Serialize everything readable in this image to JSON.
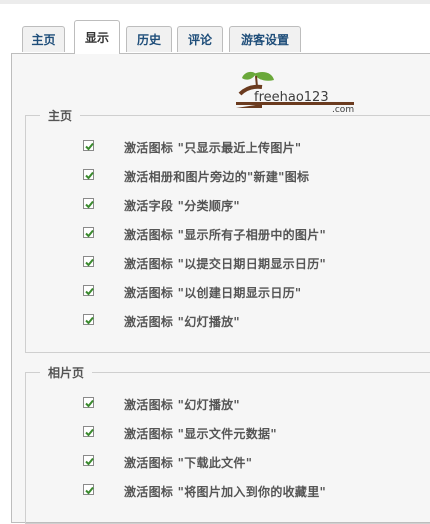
{
  "tabs": [
    {
      "label": "主页",
      "active": false
    },
    {
      "label": "显示",
      "active": true
    },
    {
      "label": "历史",
      "active": false
    },
    {
      "label": "评论",
      "active": false
    },
    {
      "label": "游客设置",
      "active": false
    }
  ],
  "logo": {
    "text": "freehao123",
    "suffix": ".com"
  },
  "sections": [
    {
      "legend": "主页",
      "items": [
        {
          "label": "激活图标 \"只显示最近上传图片\"",
          "checked": true
        },
        {
          "label": "激活相册和图片旁边的\"新建\"图标",
          "checked": true
        },
        {
          "label": "激活字段 \"分类顺序\"",
          "checked": true
        },
        {
          "label": "激活图标 \"显示所有子相册中的图片\"",
          "checked": true
        },
        {
          "label": "激活图标 \"以提交日期日期显示日历\"",
          "checked": true
        },
        {
          "label": "激活图标 \"以创建日期显示日历\"",
          "checked": true
        },
        {
          "label": "激活图标 \"幻灯播放\"",
          "checked": true
        }
      ]
    },
    {
      "legend": "相片页",
      "items": [
        {
          "label": "激活图标 \"幻灯播放\"",
          "checked": true
        },
        {
          "label": "激活图标 \"显示文件元数据\"",
          "checked": true
        },
        {
          "label": "激活图标 \"下载此文件\"",
          "checked": true
        },
        {
          "label": "激活图标 \"将图片加入到你的收藏里\"",
          "checked": true
        }
      ]
    }
  ],
  "colors": {
    "check": "#3a8a2e",
    "tab_text": "#1f4e7a",
    "logo_green": "#6aa83a",
    "logo_brown": "#6b3b1f"
  }
}
